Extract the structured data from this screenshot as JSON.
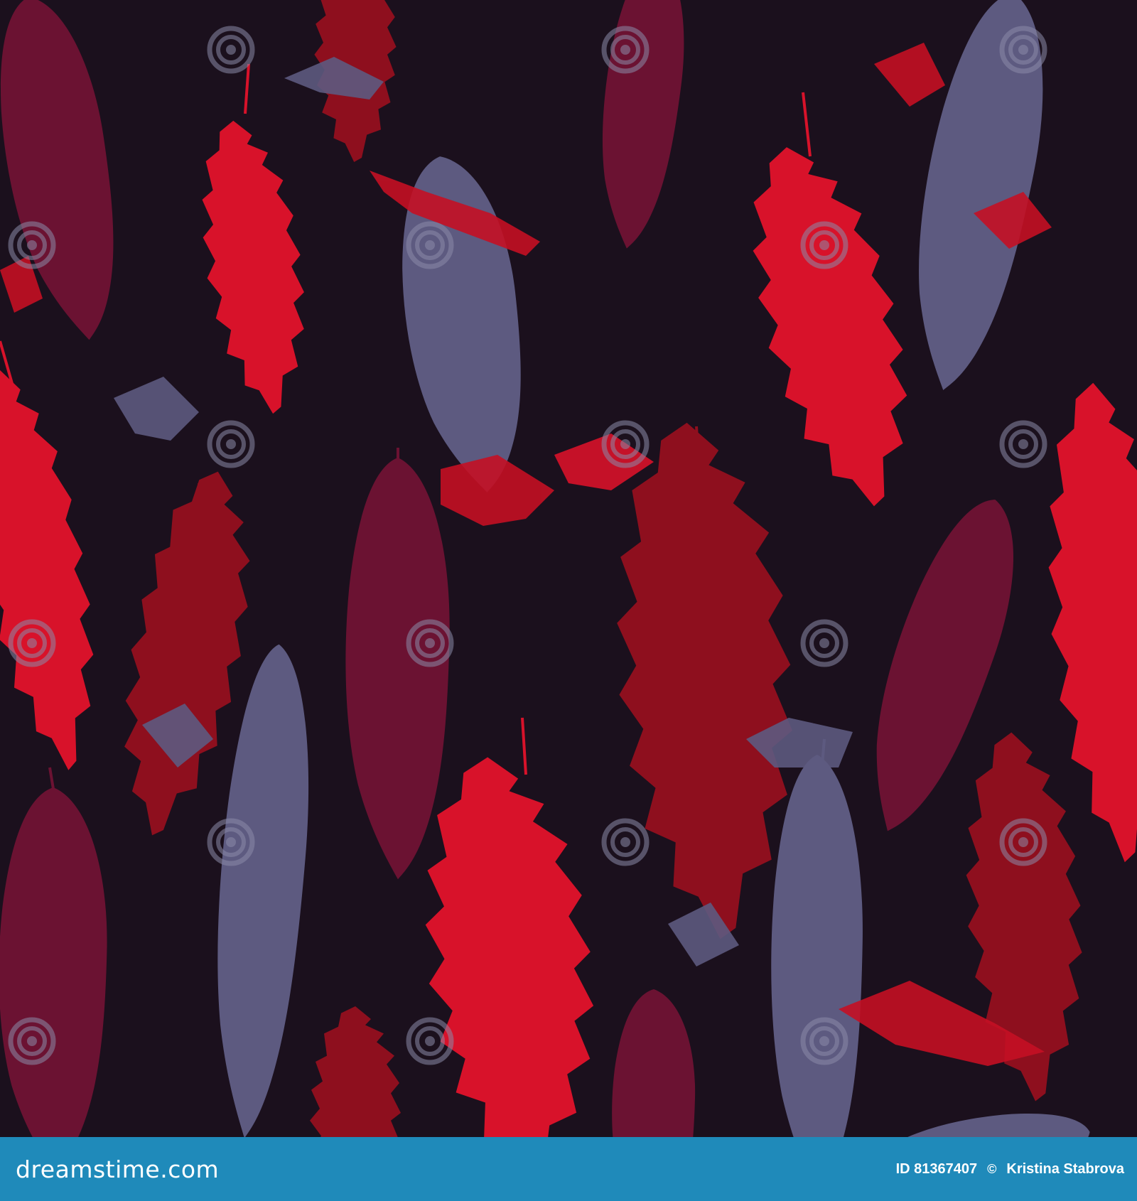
{
  "image": {
    "background_color": "#1b101d",
    "palette": {
      "bright_red": "#d8122a",
      "dark_red": "#8e0f1e",
      "plum": "#6b1232",
      "lavender": "#5d5a80",
      "splash_red": "#c41024"
    },
    "subject": "seamless grunge pattern of falling feathers"
  },
  "watermark": {
    "text": "dreamstime",
    "icon": "spiral-icon"
  },
  "footer": {
    "background_color": "#1f8aba",
    "logo_text": "dreamstime.com",
    "image_id": "ID 81367407",
    "separator_icon": "copyright-icon",
    "separator_glyph": "©",
    "author": "Kristina Stabrova"
  }
}
